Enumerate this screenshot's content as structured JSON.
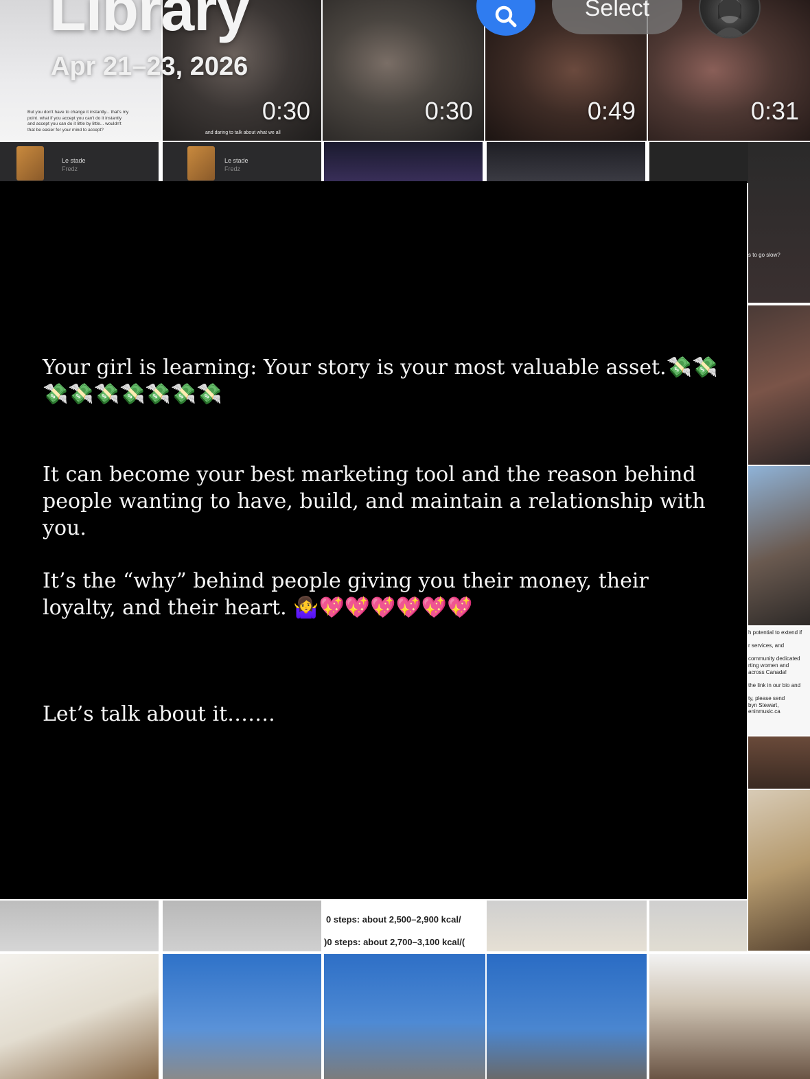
{
  "header": {
    "title": "Library",
    "date_range": "Apr 21–23, 2026",
    "select_label": "Select"
  },
  "grid": {
    "row1_durations": [
      "0:30",
      "0:30",
      "0:49",
      "0:31"
    ],
    "row2_captions": [
      {
        "title": "Le stade",
        "sub": "Fredz"
      },
      {
        "title": "Le stade",
        "sub": "Fredz"
      }
    ],
    "row1_caption_fragment": "and daring to talk about what we all",
    "first_tile_lines": [
      "But you don't have to change it instantly... that's my",
      "point. what if you accept you can't do it instantly",
      "and accept you can do it little by little... wouldn't",
      "that be easier for your mind to accept?"
    ],
    "right_column_snippets": {
      "top": "s to go slow?",
      "community": "h potential to extend if\n\nr services, and\n\ncommunity dedicated\nrting women and\nacross Canada!\n\nthe link in our bio and\n\nty, please send\nbyn Stewart,\neninmusic.ca"
    },
    "kcal_lines": [
      "0 steps: about 2,500–2,900 kcal/",
      ")0 steps: about 2,700–3,100 kcal/("
    ]
  },
  "post": {
    "paragraphs": [
      "Your girl is learning: Your story is your most valuable asset.💸💸💸💸💸💸💸💸💸",
      "It can become your best marketing tool and the reason behind people wanting to have, build, and maintain a relationship with you.",
      "It’s the “why” behind people giving you their money, their loyalty, and their heart. 🤷‍♀️💖💖💖💖💖💖",
      "Let’s talk about it……."
    ]
  },
  "icons": {
    "search": "search-icon",
    "avatar": "profile-avatar"
  },
  "colors": {
    "search_button": "#2f7cf0",
    "post_background": "#000000",
    "post_text": "#f5f5f5"
  }
}
